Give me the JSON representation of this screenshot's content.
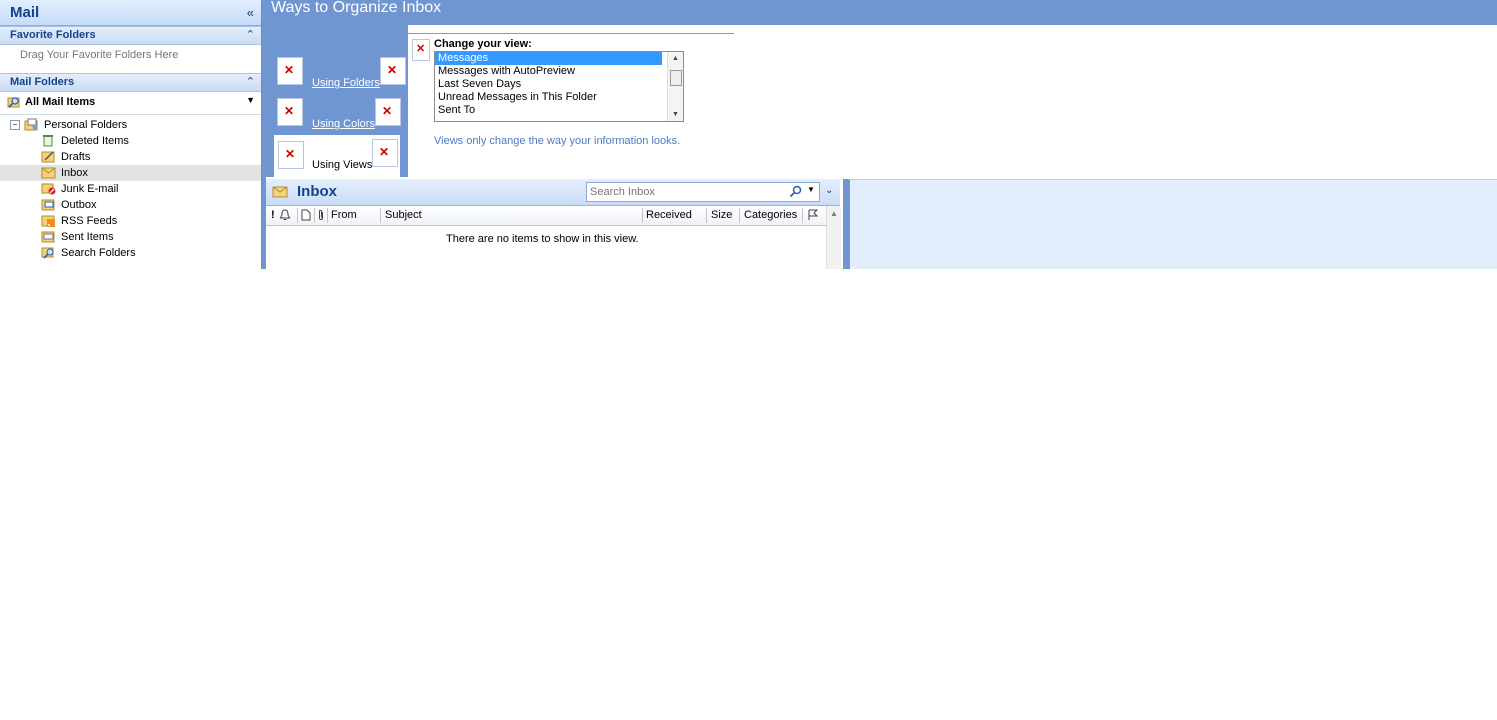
{
  "nav": {
    "title": "Mail",
    "collapse_glyph": "«",
    "favorites_header": "Favorite Folders",
    "favorites_hint": "Drag Your Favorite Folders Here",
    "mail_folders_header": "Mail Folders",
    "chevron_glyph": "⌃",
    "all_mail_items": "All Mail Items",
    "root_folder": "Personal Folders",
    "folders": [
      {
        "label": "Deleted Items",
        "icon": "deleted-items-icon"
      },
      {
        "label": "Drafts",
        "icon": "drafts-icon"
      },
      {
        "label": "Inbox",
        "icon": "inbox-folder-icon"
      },
      {
        "label": "Junk E-mail",
        "icon": "junk-email-icon"
      },
      {
        "label": "Outbox",
        "icon": "outbox-icon"
      },
      {
        "label": "RSS Feeds",
        "icon": "rss-feeds-icon"
      },
      {
        "label": "Sent Items",
        "icon": "sent-items-icon"
      },
      {
        "label": "Search Folders",
        "icon": "search-folders-icon"
      }
    ],
    "selected_folder": "Inbox"
  },
  "organize": {
    "title": "Ways to Organize Inbox",
    "tabs": [
      "Using Folders",
      "Using Colors",
      "Using Views"
    ],
    "active_tab": "Using Views",
    "change_view_label": "Change your view:",
    "views": [
      "Messages",
      "Messages with AutoPreview",
      "Last Seven Days",
      "Unread Messages in This Folder",
      "Sent To"
    ],
    "selected_view": "Messages",
    "note": "Views only change the way your information looks."
  },
  "list": {
    "folder_title": "Inbox",
    "search_placeholder": "Search Inbox",
    "columns": {
      "importance": "!",
      "from": "From",
      "subject": "Subject",
      "received": "Received",
      "size": "Size",
      "categories": "Categories"
    },
    "empty_message": "There are no items to show in this view."
  },
  "colors": {
    "accent": "#6f96d1",
    "header_text": "#15428b",
    "selection": "#3399ff",
    "reading_pane": "#e2eefc"
  }
}
